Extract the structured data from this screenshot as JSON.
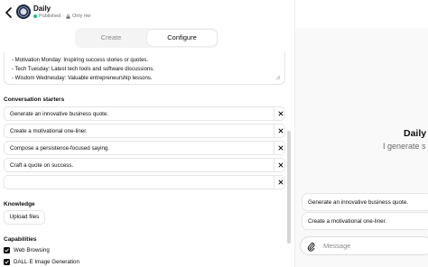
{
  "header": {
    "name": "Daily",
    "status": "Published",
    "visibility": "Only me"
  },
  "tabs": [
    {
      "label": "Create",
      "active": false
    },
    {
      "label": "Configure",
      "active": true
    }
  ],
  "instructions": {
    "lines": [
      "- Motivation Monday: Inspiring success stories or quotes.",
      "- Tech Tuesday: Latest tech tools and software discussions.",
      "- Wisdom Wednesday: Valuable entrepreneurship lessons."
    ]
  },
  "starters": {
    "label": "Conversation starters",
    "items": [
      "Generate an innovative business quote.",
      "Create a motivational one-liner.",
      "Compose a persistence-focused saying.",
      "Craft a quote on success.",
      ""
    ]
  },
  "knowledge": {
    "label": "Knowledge",
    "upload_label": "Upload files"
  },
  "capabilities": {
    "label": "Capabilities",
    "items": [
      {
        "label": "Web Browsing",
        "checked": true
      },
      {
        "label": "DALL·E Image Generation",
        "checked": true
      }
    ]
  },
  "preview": {
    "title": "Daily",
    "description": "I generate s",
    "starters": [
      "Generate an innovative business quote.",
      "Create a motivational one-liner."
    ],
    "message_placeholder": "Message"
  },
  "colors": {
    "published_dot": "#19c37d",
    "checkbox": "#0d0d0d"
  }
}
